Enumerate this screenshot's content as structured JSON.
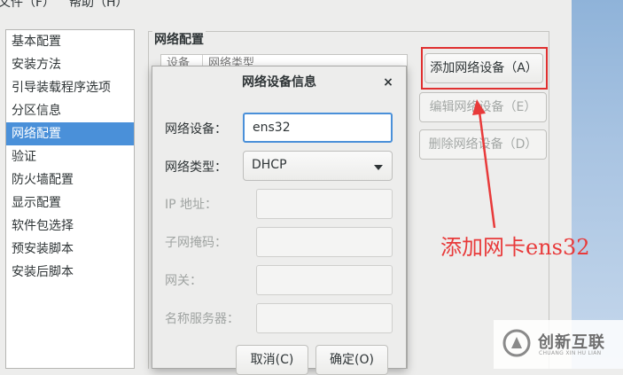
{
  "menubar": {
    "file": "文件（F）",
    "help": "帮助（H）"
  },
  "sidebar": {
    "items": [
      {
        "label": "基本配置"
      },
      {
        "label": "安装方法"
      },
      {
        "label": "引导装载程序选项"
      },
      {
        "label": "分区信息"
      },
      {
        "label": "网络配置",
        "selected": true
      },
      {
        "label": "验证"
      },
      {
        "label": "防火墙配置"
      },
      {
        "label": "显示配置"
      },
      {
        "label": "软件包选择"
      },
      {
        "label": "预安装脚本"
      },
      {
        "label": "安装后脚本"
      }
    ]
  },
  "network": {
    "section_title": "网络配置",
    "table": {
      "col_device": "设备",
      "col_type": "网络类型"
    },
    "buttons": {
      "add": "添加网络设备（A）",
      "edit": "编辑网络设备（E）",
      "delete": "删除网络设备（D）"
    }
  },
  "dialog": {
    "title": "网络设备信息",
    "close_glyph": "×",
    "device_label": "网络设备：",
    "device_value": "ens32",
    "type_label": "网络类型：",
    "type_value": "DHCP",
    "ip_label": "IP 地址：",
    "netmask_label": "子网掩码：",
    "gateway_label": "网关：",
    "dns_label": "名称服务器：",
    "cancel": "取消(C)",
    "ok": "确定(O)"
  },
  "annotation": {
    "text": "添加网卡ens32",
    "color": "#e83a3a"
  },
  "watermark": {
    "name": "创新互联",
    "sub": "CHUANG XIN HU LIAN"
  },
  "colors": {
    "selection": "#4a90d9",
    "highlight": "#e03030",
    "annotation": "#e83a3a"
  }
}
